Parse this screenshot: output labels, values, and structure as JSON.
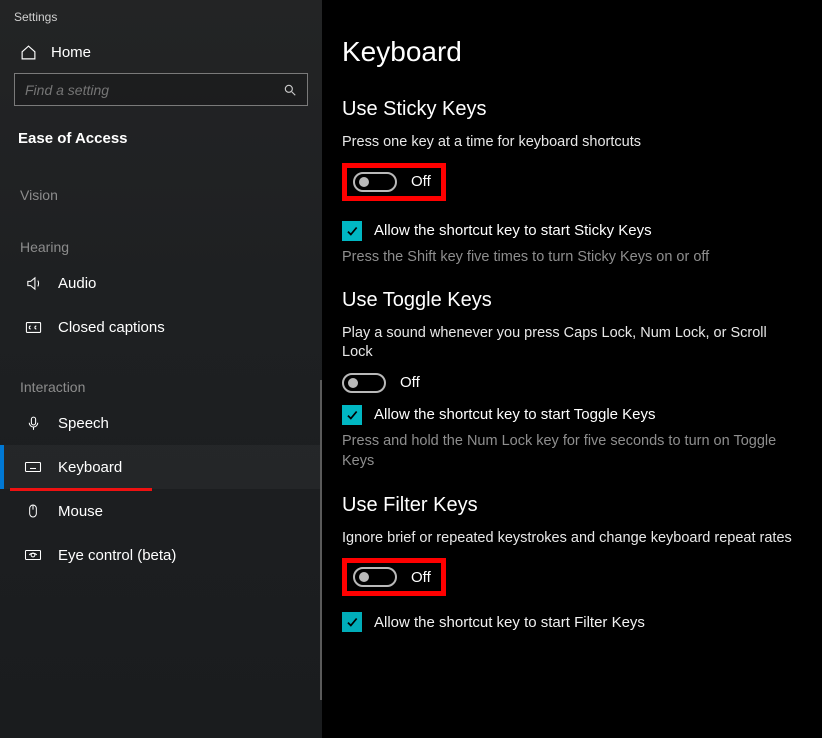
{
  "titlebar": "Settings",
  "home_label": "Home",
  "search_placeholder": "Find a setting",
  "main_group": "Ease of Access",
  "groups": {
    "vision": "Vision",
    "hearing": "Hearing",
    "interaction": "Interaction"
  },
  "nav": {
    "audio": "Audio",
    "closed_captions": "Closed captions",
    "speech": "Speech",
    "keyboard": "Keyboard",
    "mouse": "Mouse",
    "eye_control": "Eye control (beta)"
  },
  "page_title": "Keyboard",
  "sticky": {
    "title": "Use Sticky Keys",
    "desc": "Press one key at a time for keyboard shortcuts",
    "state": "Off",
    "check_label": "Allow the shortcut key to start Sticky Keys",
    "hint": "Press the Shift key five times to turn Sticky Keys on or off"
  },
  "toggle": {
    "title": "Use Toggle Keys",
    "desc": "Play a sound whenever you press Caps Lock, Num Lock, or Scroll Lock",
    "state": "Off",
    "check_label": "Allow the shortcut key to start Toggle Keys",
    "hint": "Press and hold the Num Lock key for five seconds to turn on Toggle Keys"
  },
  "filter": {
    "title": "Use Filter Keys",
    "desc": "Ignore brief or repeated keystrokes and change keyboard repeat rates",
    "state": "Off",
    "check_label": "Allow the shortcut key to start Filter Keys"
  }
}
